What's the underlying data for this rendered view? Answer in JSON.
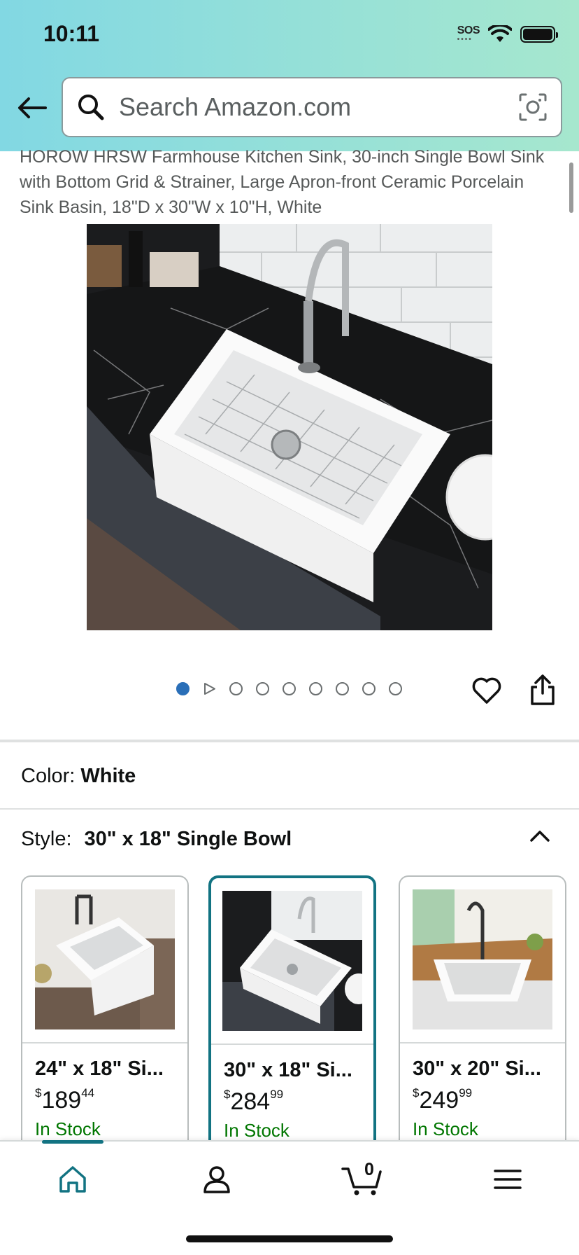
{
  "status": {
    "time": "10:11",
    "sos_label": "SOS"
  },
  "search": {
    "placeholder": "Search Amazon.com"
  },
  "product": {
    "title": "HOROW HRSW Farmhouse Kitchen Sink, 30-inch Single Bowl Sink with Bottom Grid & Strainer, Large Apron-front Ceramic Porcelain Sink Basin, 18\"D x 30\"W x 10\"H, White",
    "image_count": 9,
    "active_image_index": 0
  },
  "color": {
    "label": "Color:",
    "value": "White"
  },
  "style": {
    "label": "Style:",
    "value": "30\" x 18\" Single Bowl"
  },
  "swatches": [
    {
      "name": "24\" x 18\" Si...",
      "price_dollars": "189",
      "price_cents": "44",
      "currency": "$",
      "stock": "In Stock",
      "selected": false
    },
    {
      "name": "30\" x 18\" Si...",
      "price_dollars": "284",
      "price_cents": "99",
      "currency": "$",
      "stock": "In Stock",
      "selected": true
    },
    {
      "name": "30\" x 20\" Si...",
      "price_dollars": "249",
      "price_cents": "99",
      "currency": "$",
      "stock": "In Stock",
      "selected": false
    }
  ],
  "nav": {
    "items": [
      "home-icon",
      "account-icon",
      "cart-icon",
      "menu-icon"
    ],
    "cart_count": "0",
    "accent": "#127382"
  },
  "colors": {
    "header_start": "#82d8e3",
    "header_end": "#a6e7ce",
    "stock": "#007600",
    "selected_border": "#127382",
    "active_dot": "#2a6fb8"
  }
}
